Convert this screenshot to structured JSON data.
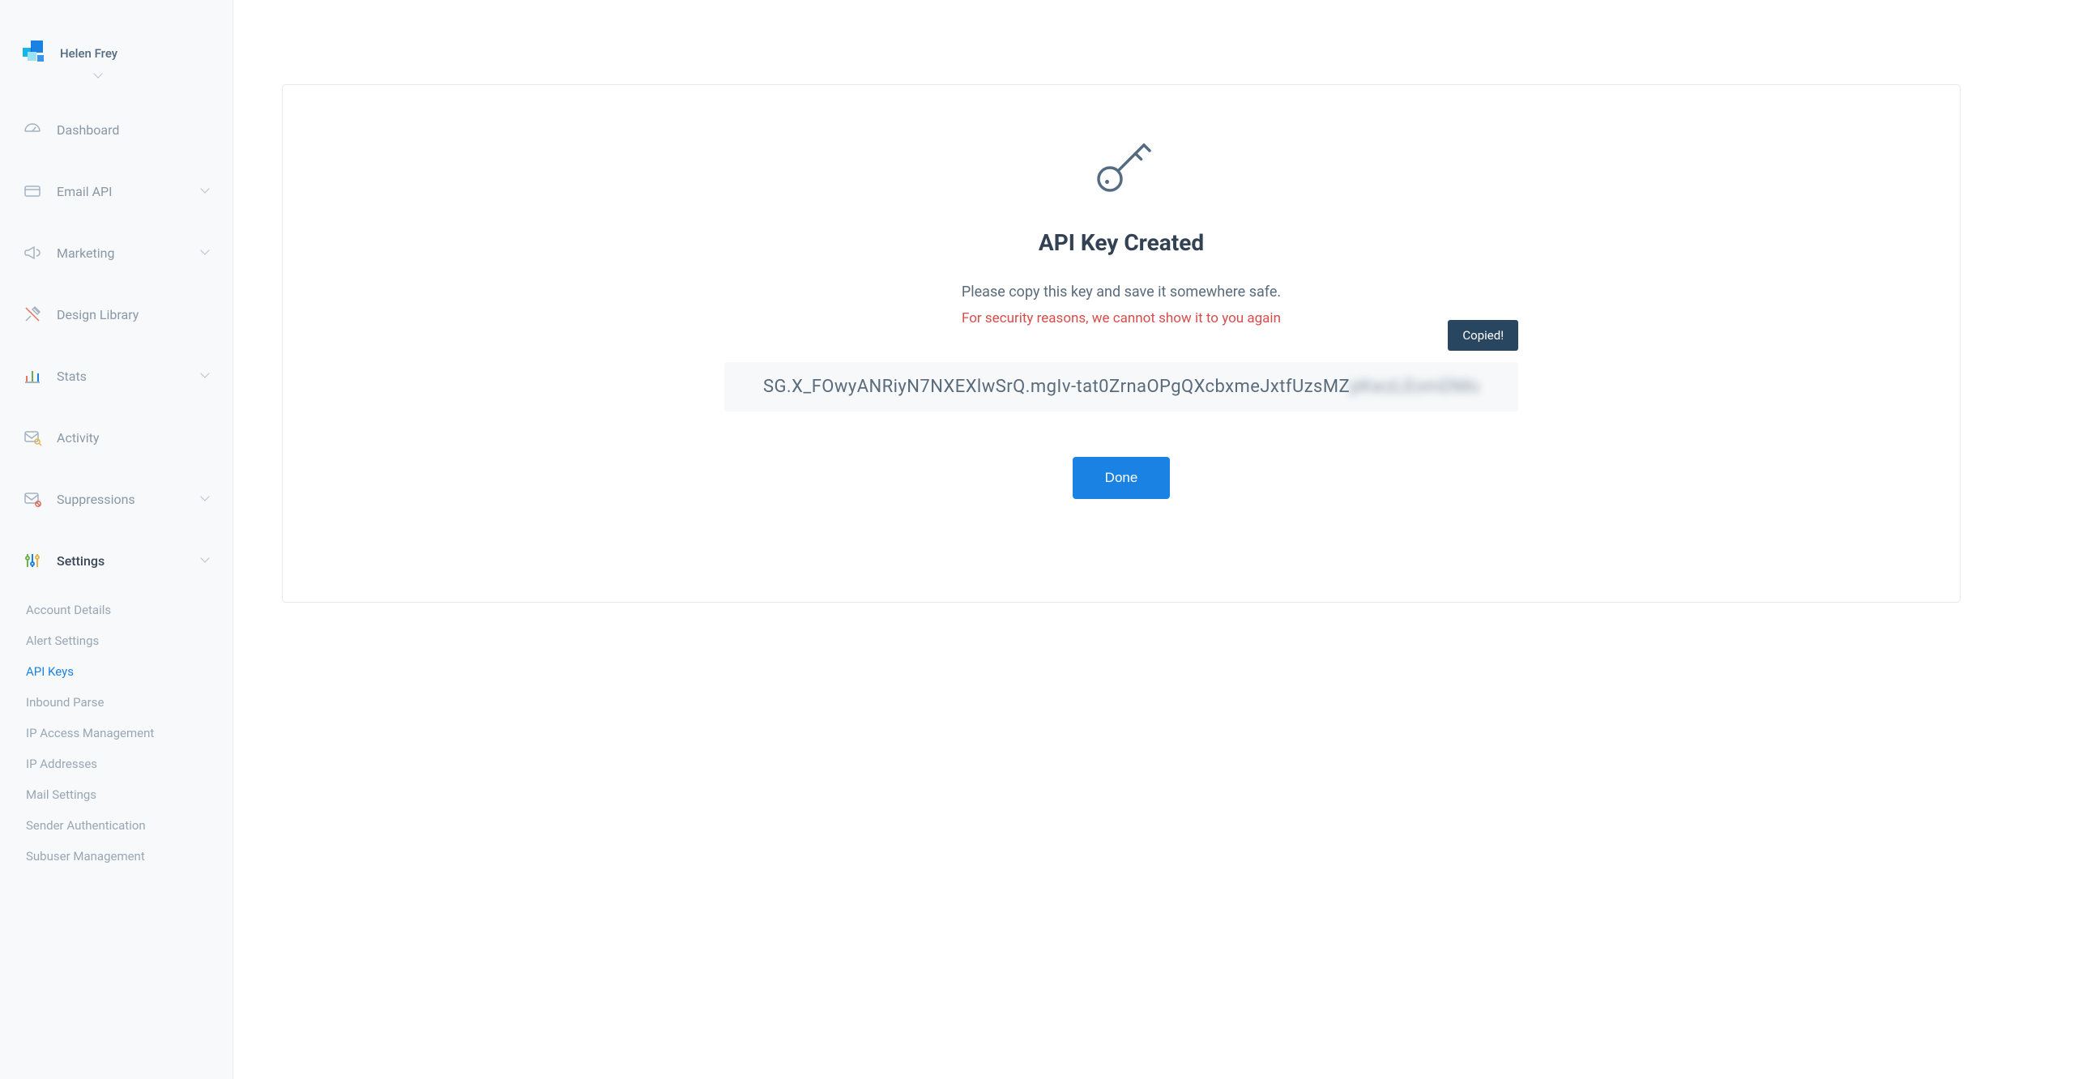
{
  "user": {
    "name": "Helen Frey"
  },
  "nav": {
    "dashboard": "Dashboard",
    "email_api": "Email API",
    "marketing": "Marketing",
    "design_library": "Design Library",
    "stats": "Stats",
    "activity": "Activity",
    "suppressions": "Suppressions",
    "settings": "Settings"
  },
  "settings_sub": {
    "account_details": "Account Details",
    "alert_settings": "Alert Settings",
    "api_keys": "API Keys",
    "inbound_parse": "Inbound Parse",
    "ip_access": "IP Access Management",
    "ip_addresses": "IP Addresses",
    "mail_settings": "Mail Settings",
    "sender_auth": "Sender Authentication",
    "subuser_mgmt": "Subuser Management"
  },
  "panel": {
    "title": "API Key Created",
    "msg1": "Please copy this key and save it somewhere safe.",
    "msg2": "For security reasons, we cannot show it to you again",
    "api_key_visible": "SG.X_FOwyANRiyN7NXEXlwSrQ.mgIv-tat0ZrnaOPgQXcbxmeJxtfUzsMZ",
    "api_key_hidden": "pKwzLEomDMo",
    "tooltip": "Copied!",
    "done": "Done"
  }
}
